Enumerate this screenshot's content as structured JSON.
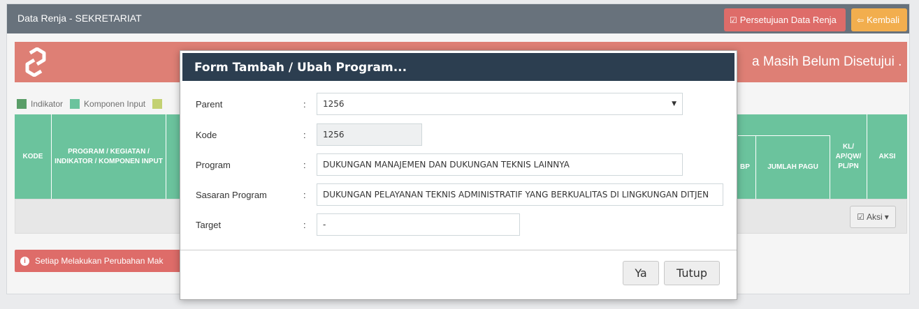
{
  "header": {
    "title": "Data Renja - SEKRETARIAT",
    "approval_button": "Persetujuan Data Renja",
    "back_button": "Kembali"
  },
  "banner": {
    "text": "a Masih Belum Disetujui ."
  },
  "legend": [
    {
      "label": "Indikator",
      "color": "#3e8e4e"
    },
    {
      "label": "Komponen Input",
      "color": "#52b98c"
    },
    {
      "label": "",
      "color": "#b9c95a"
    }
  ],
  "table": {
    "headers": {
      "kode": "KODE",
      "program": "PROGRAM / KEGIATAN / INDIKATOR / KOMPONEN INPUT",
      "bp": "BP",
      "jumlah_pagu": "JUMLAH PAGU",
      "kl": "KL/ AP/QW/ PL/PN",
      "aksi": "AKSI"
    },
    "row_action": "Aksi"
  },
  "note": {
    "text": "Setiap Melakukan Perubahan Mak"
  },
  "modal": {
    "title": "Form Tambah / Ubah Program...",
    "fields": {
      "parent": {
        "label": "Parent",
        "value": "1256"
      },
      "kode": {
        "label": "Kode",
        "value": "1256"
      },
      "program": {
        "label": "Program",
        "value": "DUKUNGAN MANAJEMEN DAN DUKUNGAN TEKNIS LAINNYA"
      },
      "sasaran": {
        "label": "Sasaran Program",
        "value": "DUKUNGAN PELAYANAN TEKNIS ADMINISTRATIF YANG BERKUALITAS DI LINGKUNGAN DITJEN"
      },
      "target": {
        "label": "Target",
        "value": "-"
      }
    },
    "colon": ":",
    "buttons": {
      "yes": "Ya",
      "close": "Tutup"
    }
  },
  "colors": {
    "header_bg": "#4e5a66",
    "danger": "#d9534f",
    "warning": "#f0a030",
    "table_green": "#52b98c",
    "modal_head": "#2c3e50"
  }
}
